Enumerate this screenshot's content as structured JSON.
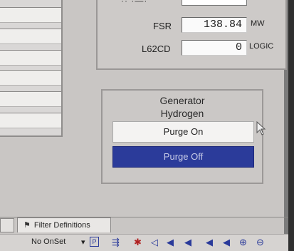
{
  "fields": {
    "fsr_label": "FSR",
    "fsr_value": "138.84",
    "fsr_unit": "MW",
    "l62cd_label": "L62CD",
    "l62cd_value": "0",
    "l62cd_unit": "LOGIC"
  },
  "generator": {
    "title_line1": "Generator",
    "title_line2": "Hydrogen",
    "purge_on_label": "Purge On",
    "purge_off_label": "Purge Off"
  },
  "tabs": {
    "filter_definitions": "Filter Definitions"
  },
  "toolbar": {
    "no_onset_label": "No OnSet",
    "dropdown_arrow": "▾",
    "p_button": "P"
  },
  "colors": {
    "purge_off_bg": "#2b3b9a",
    "panel_bg": "#c9c6c4"
  },
  "icons": [
    "grid-icon",
    "bookmark-icon",
    "cursor-left-icon",
    "marker-left-icon",
    "marker-pair-icon",
    "speaker-marker-icon",
    "marker-right-icon",
    "zoom-in-icon",
    "zoom-out-icon"
  ]
}
